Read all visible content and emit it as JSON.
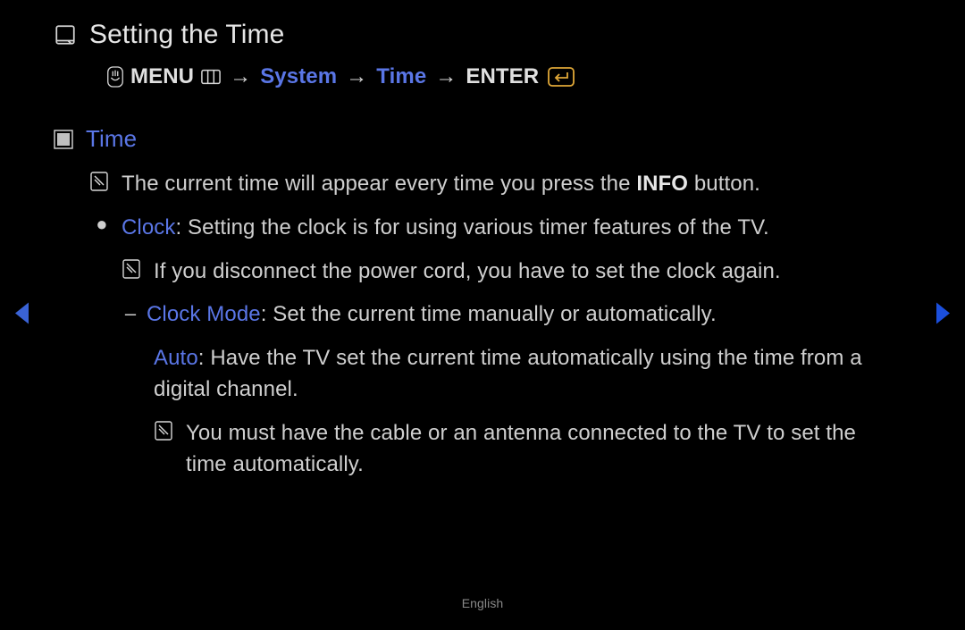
{
  "title": "Setting the Time",
  "nav": {
    "menu": "MENU",
    "system": "System",
    "time": "Time",
    "enter": "ENTER",
    "arrow": "→"
  },
  "section": {
    "heading": "Time",
    "note_info_pre": "The current time will appear every time you press the ",
    "note_info_bold": "INFO",
    "note_info_post": " button.",
    "clock_label": "Clock",
    "clock_text": ": Setting the clock is for using various timer features of the TV.",
    "clock_note": "If you disconnect the power cord, you have to set the clock again.",
    "clock_mode_label": "Clock Mode",
    "clock_mode_text": ": Set the current time manually or automatically.",
    "auto_label": "Auto",
    "auto_text": ": Have the TV set the current time automatically using the time from a digital channel.",
    "auto_note": "You must have the cable or an antenna connected to the TV to set the time automatically."
  },
  "footer": "English"
}
